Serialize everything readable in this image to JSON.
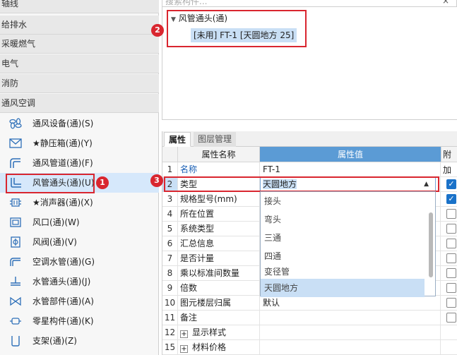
{
  "sidebar": {
    "categories": [
      "轴线",
      "给排水",
      "采暖燃气",
      "电气",
      "消防",
      "通风空调"
    ],
    "items": [
      {
        "label": "通风设备(通)(S)",
        "icon": "fan-icon"
      },
      {
        "label": "★静压箱(通)(Y)",
        "icon": "box-icon"
      },
      {
        "label": "通风管道(通)(F)",
        "icon": "duct-icon"
      },
      {
        "label": "风管通头(通)(U)",
        "icon": "duct-fitting-icon"
      },
      {
        "label": "★消声器(通)(X)",
        "icon": "silencer-icon"
      },
      {
        "label": "风口(通)(W)",
        "icon": "vent-icon"
      },
      {
        "label": "风阀(通)(V)",
        "icon": "damper-icon"
      },
      {
        "label": "空调水管(通)(G)",
        "icon": "pipe-icon"
      },
      {
        "label": "水管通头(通)(J)",
        "icon": "pipe-fitting-icon"
      },
      {
        "label": "水管部件(通)(A)",
        "icon": "valve-icon"
      },
      {
        "label": "零星构件(通)(K)",
        "icon": "component-icon"
      },
      {
        "label": "支架(通)(Z)",
        "icon": "bracket-icon"
      }
    ]
  },
  "search": {
    "placeholder": "搜索构件...",
    "clear": "×"
  },
  "tree": {
    "root": "风管通头(通)",
    "child": "[未用] FT-1 [天圆地方 25]"
  },
  "badges": [
    "1",
    "2",
    "3"
  ],
  "tabs": [
    "属性",
    "图层管理"
  ],
  "headers": {
    "name": "属性名称",
    "value": "属性值",
    "extra": "附加"
  },
  "rows": [
    {
      "num": "1",
      "name": "名称",
      "value": "FT-1"
    },
    {
      "num": "2",
      "name": "类型",
      "value": "天圆地方"
    },
    {
      "num": "3",
      "name": "规格型号(mm)",
      "value": ""
    },
    {
      "num": "4",
      "name": "所在位置",
      "value": ""
    },
    {
      "num": "5",
      "name": "系统类型",
      "value": ""
    },
    {
      "num": "6",
      "name": "汇总信息",
      "value": ""
    },
    {
      "num": "7",
      "name": "是否计量",
      "value": ""
    },
    {
      "num": "8",
      "name": "乘以标准间数量",
      "value": ""
    },
    {
      "num": "9",
      "name": "倍数",
      "value": ""
    },
    {
      "num": "10",
      "name": "图元楼层归属",
      "value": "默认"
    },
    {
      "num": "11",
      "name": "备注",
      "value": ""
    },
    {
      "num": "12",
      "name": "显示样式",
      "value": ""
    },
    {
      "num": "15",
      "name": "材料价格",
      "value": ""
    }
  ],
  "dropdown": {
    "selected": "天圆地方",
    "options": [
      "接头",
      "弯头",
      "三通",
      "四通",
      "变径管",
      "天圆地方"
    ]
  },
  "colors": {
    "accent": "#1a72c9",
    "highlight": "#d9262f",
    "selection": "#c9dff5",
    "header_blue": "#5b9bd5"
  }
}
